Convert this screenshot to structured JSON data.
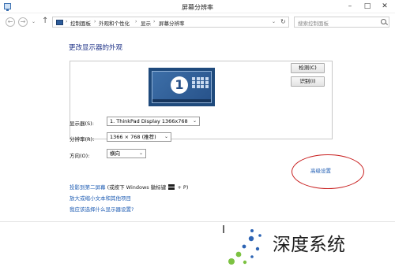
{
  "window": {
    "title": "屏幕分辨率",
    "minimize": "–",
    "maximize": "□",
    "close": "✕"
  },
  "address": {
    "crumbs": [
      "控制面板",
      "外观和个性化",
      "显示",
      "屏幕分辨率"
    ],
    "sep": "›",
    "dropdown": "⌄",
    "refresh": "↻",
    "search_placeholder": "搜索控制面板"
  },
  "nav": {
    "back": "←",
    "forward": "→",
    "history": "⌄",
    "up": "↑"
  },
  "page": {
    "title": "更改显示器的外观",
    "monitor_number": "1",
    "detect_button": "检测(C)",
    "identify_button": "识别(I)"
  },
  "form": {
    "display_label": "显示器(S):",
    "display_value": "1. ThinkPad Display 1366x768",
    "resolution_label": "分辨率(R):",
    "resolution_value": "1366 × 768 (推荐)",
    "orientation_label": "方向(O):",
    "orientation_value": "横向",
    "chevron": "⌄"
  },
  "links": {
    "advanced": "高级设置",
    "project_part1": "投影到第二屏幕",
    "project_part2": "(或按下 Windows 徽标键",
    "project_part3": "+ P)",
    "text_size": "放大或缩小文本和其他项目",
    "which_settings": "我应该选择什么显示器设置?"
  },
  "watermark": {
    "text": "深度系统"
  },
  "colors": {
    "accent_link": "#1e5cb3",
    "title_blue": "#1e3287",
    "highlight_circle": "#c81e1e",
    "monitor_blue": "#1f4a7c"
  }
}
